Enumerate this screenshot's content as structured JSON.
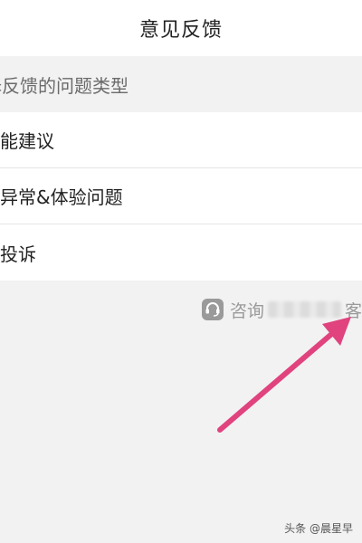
{
  "header": {
    "title": "意见反馈"
  },
  "section": {
    "label": "择反馈的问题类型"
  },
  "feedback_types": [
    {
      "label": "功能建议"
    },
    {
      "label": "能异常&体验问题"
    },
    {
      "label": "务投诉"
    }
  ],
  "consult": {
    "icon": "customer-service-icon",
    "prefix": "咨询",
    "suffix": "客"
  },
  "annotation": {
    "arrow_color": "#e0437e"
  },
  "watermark": {
    "text": "头条 @晨星早"
  }
}
